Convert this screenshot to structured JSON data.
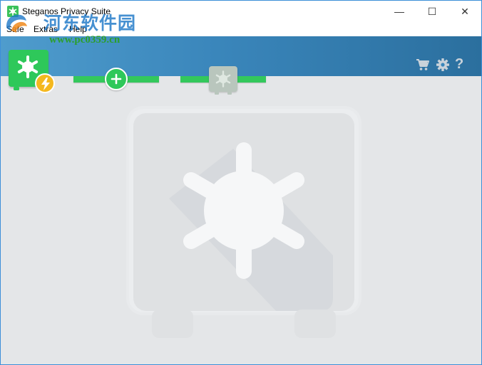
{
  "window": {
    "title": "Steganos Privacy Suite",
    "controls": {
      "minimize": "—",
      "maximize": "☐",
      "close": "✕"
    }
  },
  "menu": {
    "safe": "Safe",
    "extras": "Extras",
    "help": "Help"
  },
  "watermark": {
    "site_name": "河东软件园",
    "url": "www.pc0359.cn"
  },
  "toolbar": {
    "icons": [
      "cart-icon",
      "gear-icon",
      "help-icon"
    ],
    "help_glyph": "?"
  },
  "colors": {
    "accent_green": "#2ec85a",
    "toolbar_blue": "#3a86bb",
    "badge_yellow": "#f4b81f",
    "background": "#e4e6e8"
  }
}
